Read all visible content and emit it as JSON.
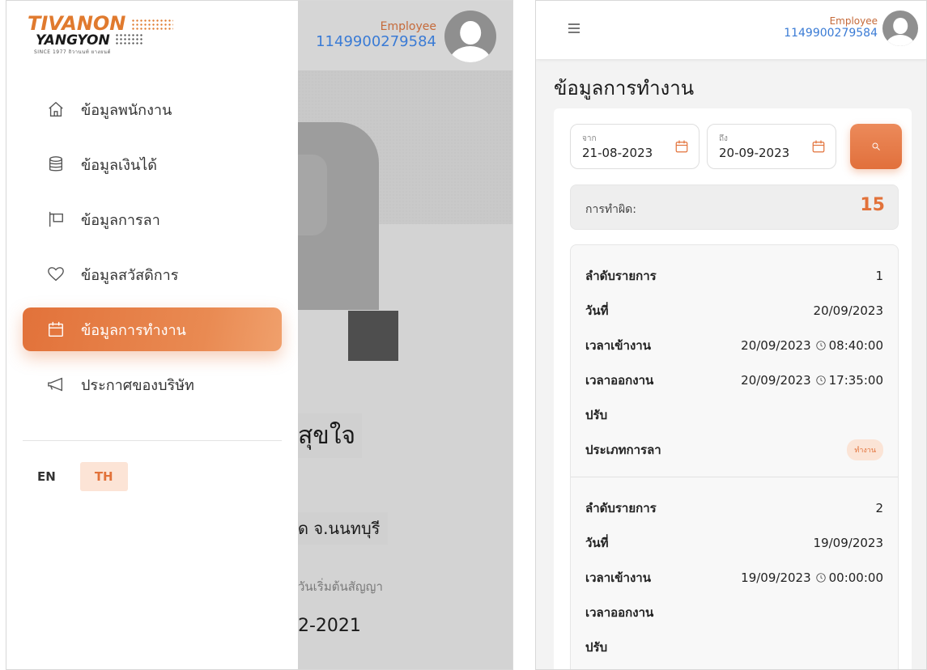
{
  "left": {
    "logo": {
      "line1": "TIVANON",
      "line2": "YANGYON",
      "line3": "SINCE 1977 ถิวานนท์ ยางยนต์"
    },
    "employee_label": "Employee",
    "employee_id": "1149900279584",
    "menu": [
      {
        "label": "ข้อมูลพนักงาน",
        "icon": "home-icon"
      },
      {
        "label": "ข้อมูลเงินได้",
        "icon": "database-icon"
      },
      {
        "label": "ข้อมูลการลา",
        "icon": "signpost-icon"
      },
      {
        "label": "ข้อมูลสวัสดิการ",
        "icon": "heart-icon"
      },
      {
        "label": "ข้อมูลการทำงาน",
        "icon": "calendar-icon",
        "active": true
      },
      {
        "label": "ประกาศของบริษัท",
        "icon": "megaphone-icon"
      }
    ],
    "lang_en": "EN",
    "lang_th": "TH",
    "background_texts": {
      "name": "สุขใจ",
      "province": "ด จ.นนทบุรี",
      "contract_label": "วันเริ่มต้นสัญญา",
      "contract_value": "2-2021"
    }
  },
  "right": {
    "employee_label": "Employee",
    "employee_id": "1149900279584",
    "title": "ข้อมูลการทำงาน",
    "from_label": "จาก",
    "from_value": "21-08-2023",
    "to_label": "ถึง",
    "to_value": "20-09-2023",
    "mistake_label": "การทำผิด:",
    "mistake_value": "15",
    "records": [
      {
        "rows": [
          {
            "k": "ลำดับรายการ",
            "v": "1"
          },
          {
            "k": "วันที่",
            "v": "20/09/2023"
          },
          {
            "k": "เวลาเข้างาน",
            "date": "20/09/2023",
            "time": "08:40:00"
          },
          {
            "k": "เวลาออกงาน",
            "date": "20/09/2023",
            "time": "17:35:00"
          },
          {
            "k": "ปรับ",
            "v": ""
          },
          {
            "k": "ประเภทการลา",
            "badge": "ทำงาน"
          }
        ]
      },
      {
        "rows": [
          {
            "k": "ลำดับรายการ",
            "v": "2"
          },
          {
            "k": "วันที่",
            "v": "19/09/2023"
          },
          {
            "k": "เวลาเข้างาน",
            "date": "19/09/2023",
            "time": "00:00:00"
          },
          {
            "k": "เวลาออกงาน",
            "v": ""
          },
          {
            "k": "ปรับ",
            "v": ""
          }
        ]
      }
    ]
  },
  "colors": {
    "accent": "#e2723a",
    "link": "#3a7bd5",
    "badge_bg": "#fbe4d6"
  }
}
